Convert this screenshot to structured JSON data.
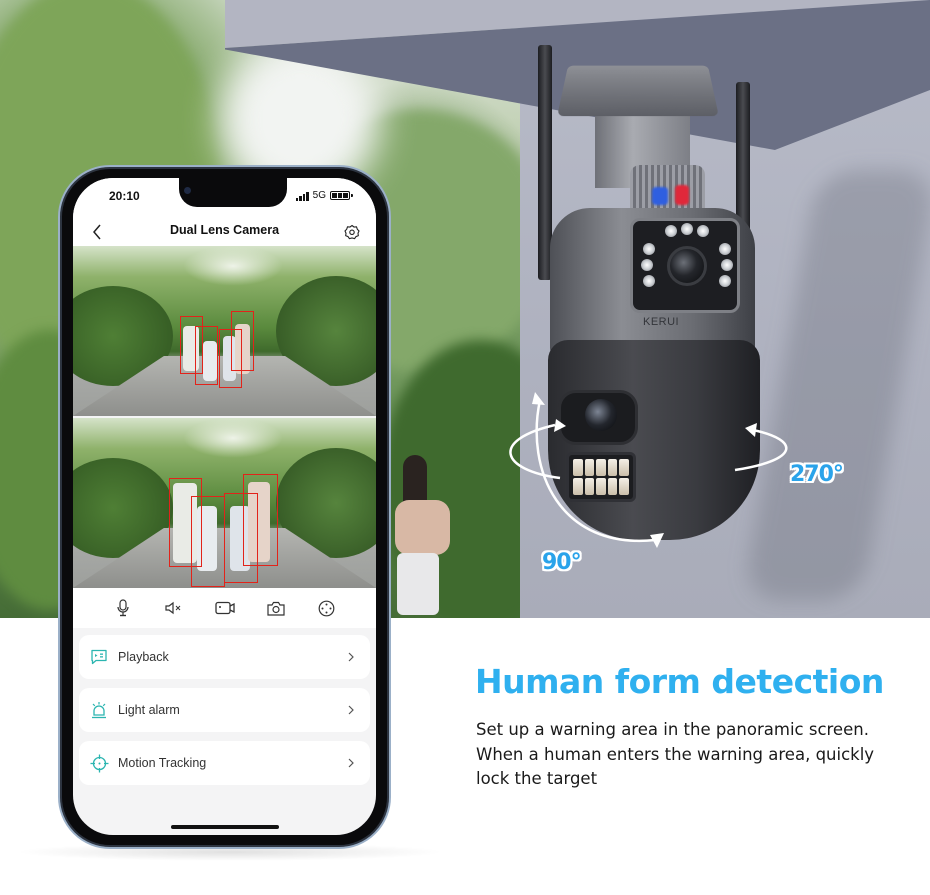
{
  "scene": {
    "camera_brand": "KERUI",
    "rotation_labels": {
      "horizontal": "270°",
      "vertical": "90°"
    },
    "accent_color": "#2fb0ef"
  },
  "phone": {
    "status_bar": {
      "time": "20:10",
      "network": "5G"
    },
    "nav": {
      "title": "Dual Lens Camera",
      "back_icon": "chevron-left-icon",
      "settings_icon": "settings-gear-icon"
    },
    "feeds": [
      {
        "label": "upper-lens-feed",
        "detections": 4
      },
      {
        "label": "lower-lens-feed",
        "detections": 4
      }
    ],
    "controls": [
      {
        "name": "microphone-button",
        "icon": "microphone-icon"
      },
      {
        "name": "mute-button",
        "icon": "speaker-mute-icon"
      },
      {
        "name": "record-button",
        "icon": "video-record-icon"
      },
      {
        "name": "snapshot-button",
        "icon": "camera-icon"
      },
      {
        "name": "ptz-button",
        "icon": "direction-pad-icon"
      }
    ],
    "menu": [
      {
        "label": "Playback",
        "icon": "playback-icon"
      },
      {
        "label": "Light alarm",
        "icon": "siren-alarm-icon"
      },
      {
        "label": "Motion Tracking",
        "icon": "crosshair-target-icon"
      }
    ],
    "menu_icon_color": "#2bb5b0"
  },
  "panel": {
    "headline": "Human form detection",
    "description": "Set up a warning area in the panoramic screen. When a human enters the warning area, quickly lock the target"
  }
}
